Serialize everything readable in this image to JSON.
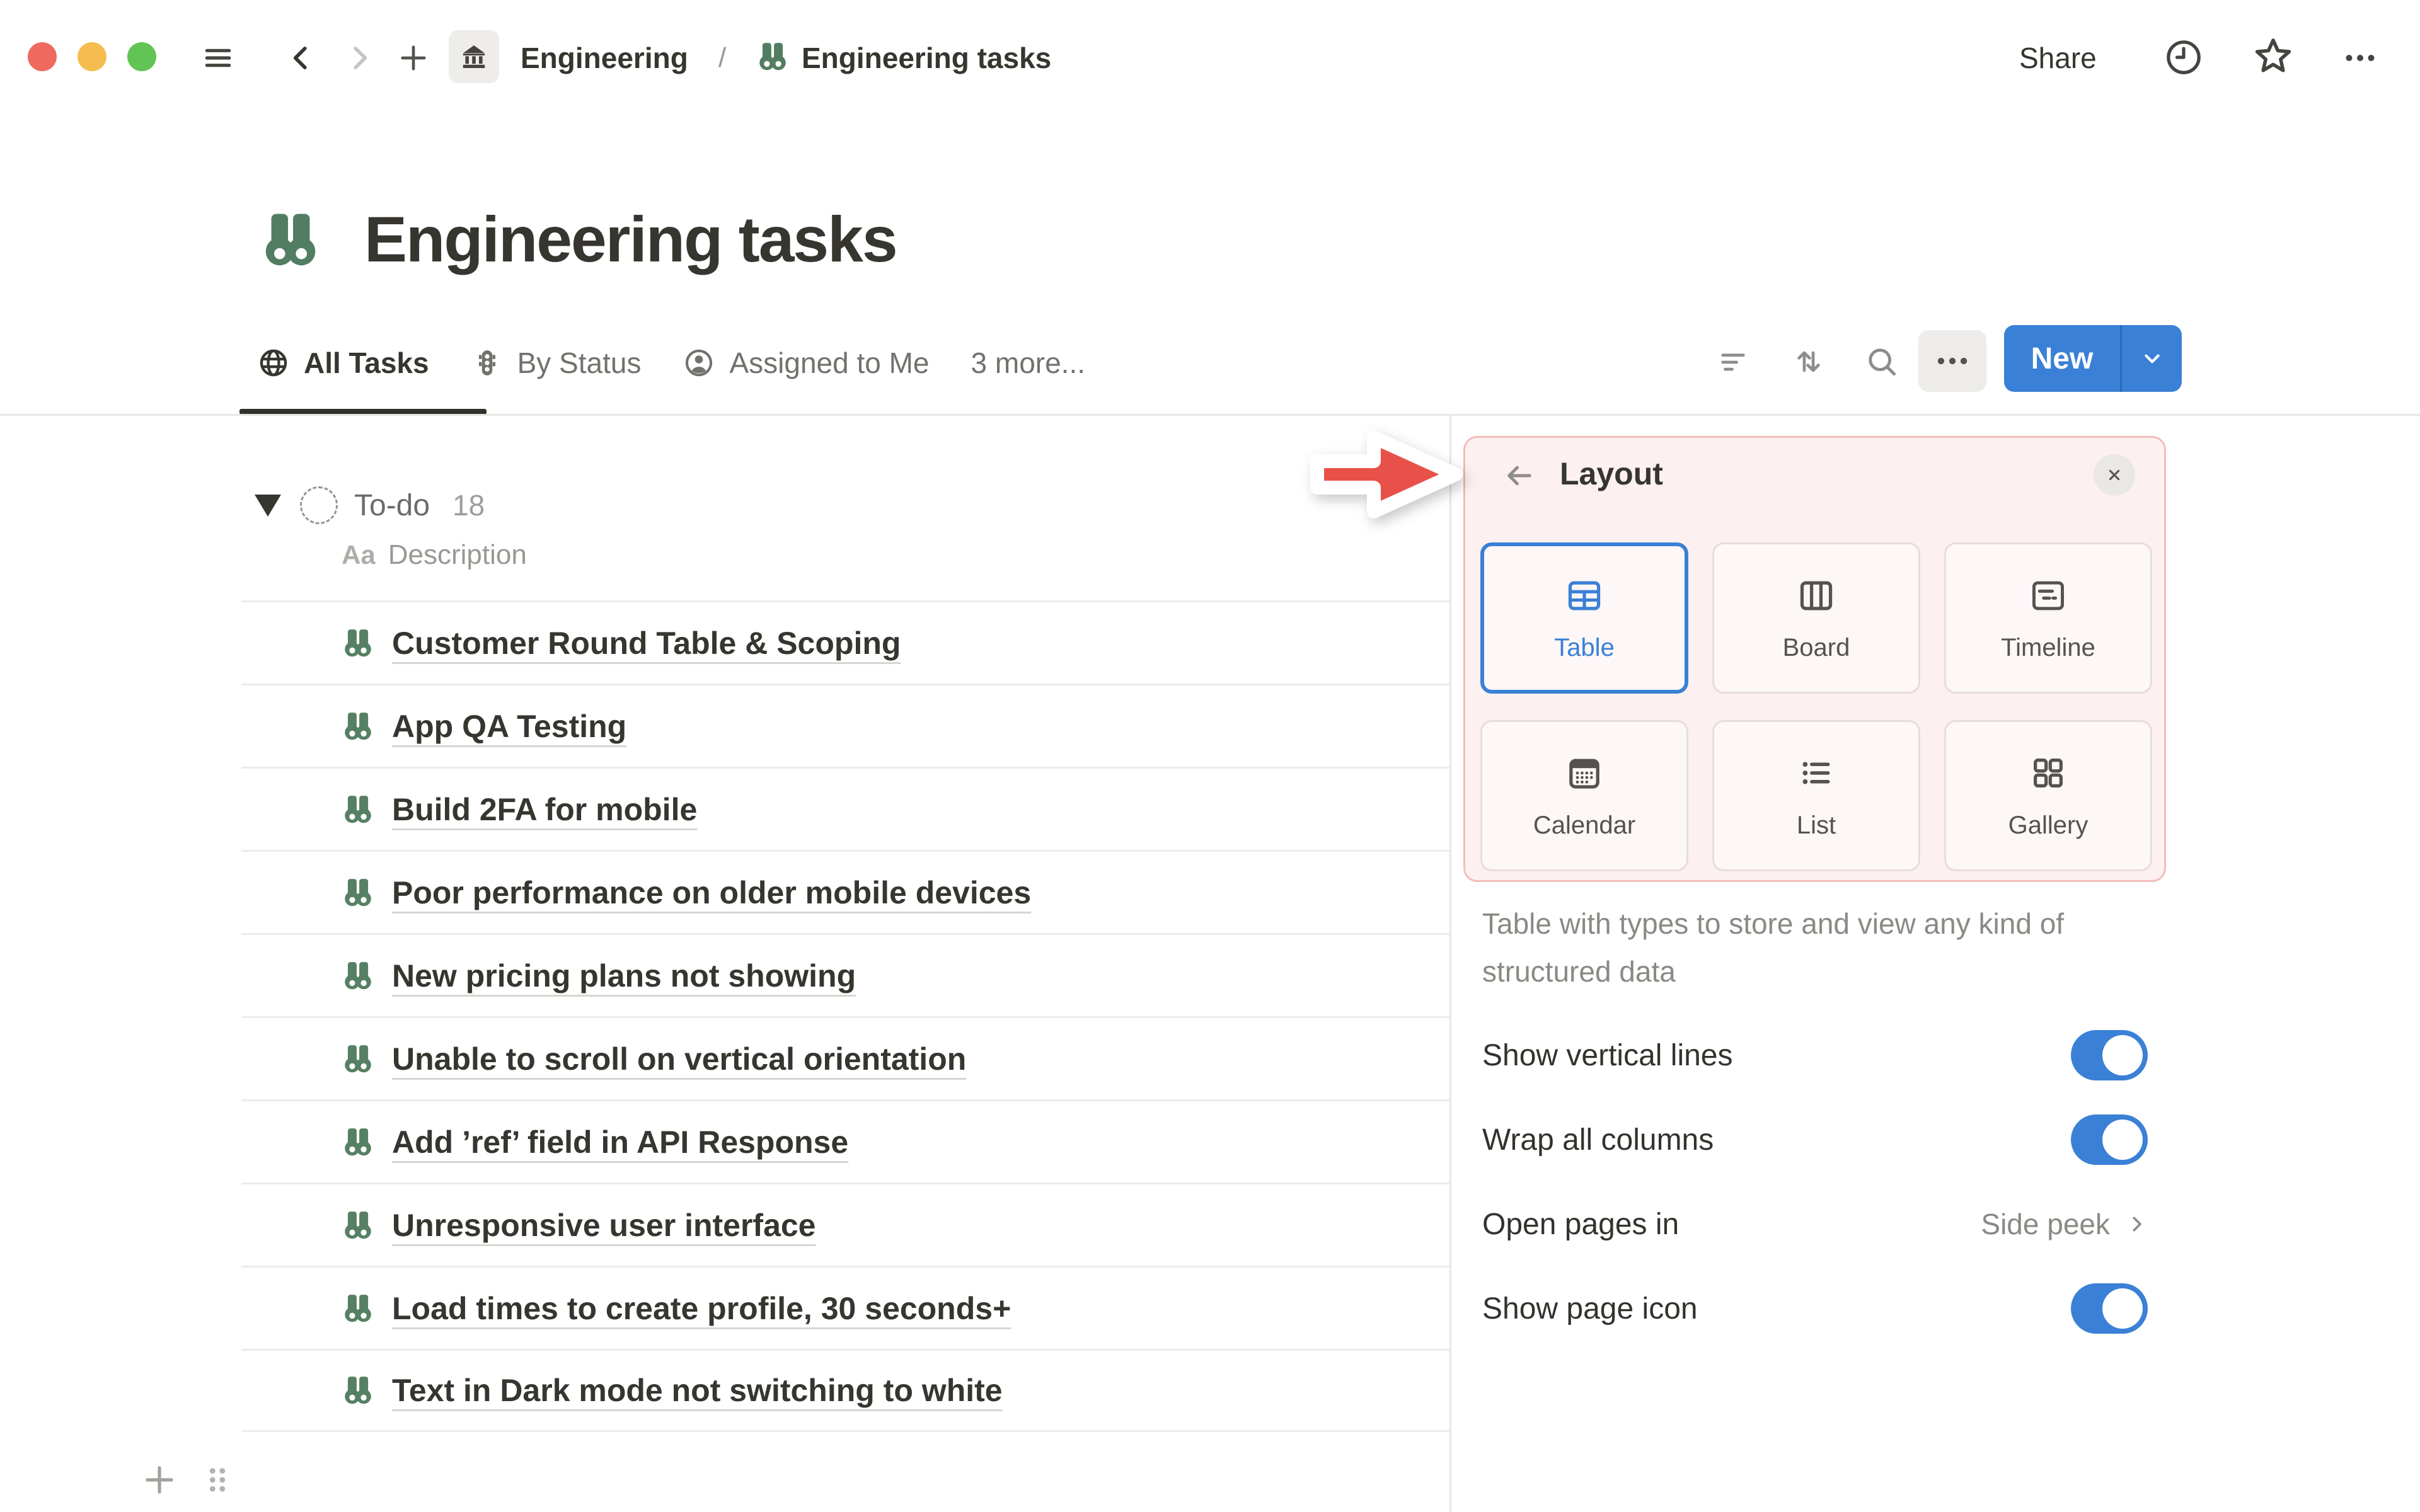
{
  "window": {
    "traffic_lights": [
      "#ee6a5e",
      "#f5bd4f",
      "#61c454"
    ]
  },
  "topbar": {
    "breadcrumb": {
      "workspace": "Engineering",
      "separator": "/",
      "page": "Engineering tasks"
    },
    "share_label": "Share"
  },
  "page": {
    "icon": "binoculars-icon",
    "title": "Engineering tasks"
  },
  "view_tabs": {
    "tabs": [
      {
        "label": "All Tasks",
        "icon": "globe-icon",
        "active": true
      },
      {
        "label": "By Status",
        "icon": "status-icon",
        "active": false
      },
      {
        "label": "Assigned to Me",
        "icon": "person-icon",
        "active": false
      },
      {
        "label": "3 more...",
        "icon": null,
        "active": false
      }
    ],
    "new_button": "New"
  },
  "board": {
    "group": {
      "name": "To-do",
      "count": "18"
    },
    "column": {
      "type": "Aa",
      "header": "Description"
    },
    "rows": [
      "Customer Round Table & Scoping",
      "App QA Testing",
      "Build 2FA for mobile",
      "Poor performance on older mobile devices",
      "New pricing plans not showing",
      "Unable to scroll on vertical orientation",
      "Add ’ref’ field in API Response",
      "Unresponsive user interface",
      "Load times to create profile, 30 seconds+",
      "Text in Dark mode not switching to white"
    ]
  },
  "panel": {
    "title": "Layout",
    "layout_options": [
      {
        "label": "Table",
        "selected": true
      },
      {
        "label": "Board",
        "selected": false
      },
      {
        "label": "Timeline",
        "selected": false
      },
      {
        "label": "Calendar",
        "selected": false
      },
      {
        "label": "List",
        "selected": false
      },
      {
        "label": "Gallery",
        "selected": false
      }
    ],
    "description": "Table with types to store and view any kind of structured data",
    "settings": {
      "vertical_lines": {
        "label": "Show vertical lines",
        "value": "on"
      },
      "wrap_columns": {
        "label": "Wrap all columns",
        "value": "on"
      },
      "open_pages": {
        "label": "Open pages in",
        "value": "Side peek"
      },
      "page_icon": {
        "label": "Show page icon",
        "value": "on"
      }
    }
  },
  "colors": {
    "accent_blue": "#3a80d6",
    "notion_green": "#527d62",
    "arrow_red": "#e8514a",
    "highlight_bg": "#fcf1f0",
    "highlight_border": "#f3bdb8",
    "text_dark": "#37352f",
    "text_gray": "#787671"
  }
}
